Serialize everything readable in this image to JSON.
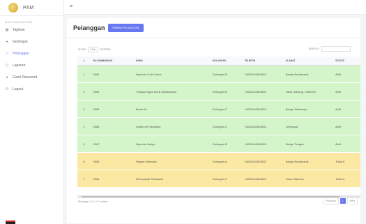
{
  "app": {
    "name": "PAM"
  },
  "sidebar": {
    "header": "MAIN NAVIGATION",
    "items": [
      {
        "label": "Tagihan",
        "icon": "table-icon"
      },
      {
        "label": "Golongan",
        "icon": "circle-icon"
      },
      {
        "label": "Pelanggan",
        "icon": "users-icon",
        "active": true
      },
      {
        "label": "Laporan",
        "icon": "document-icon"
      },
      {
        "label": "Ganti Password",
        "icon": "key-icon"
      },
      {
        "label": "Logout",
        "icon": "power-icon"
      }
    ]
  },
  "topbar": {
    "menu_icon": "hamburger-icon"
  },
  "page": {
    "title": "Pelanggan",
    "add_button": "TAMBAH PELANGGAN"
  },
  "table_controls": {
    "show_label": "SHOW",
    "show_value": "10",
    "entries_label": "ENTRIES",
    "search_label": "SEARCH:"
  },
  "table": {
    "columns": [
      "#",
      "NO SAMBUNGAN",
      "NAMA",
      "GOLONGAN",
      "TELEPON",
      "ALAMAT",
      "STATUS"
    ],
    "rows": [
      {
        "no": "1",
        "samb": "0081",
        "nama": "Nyoman Yudi Utama",
        "gol": "Golongan B",
        "tel": "+6282146824652",
        "alamat": "Banjar Budamanis",
        "status": "Aktif",
        "color": "green"
      },
      {
        "no": "2",
        "samb": "0082",
        "nama": "I Wayan Agus Nova Swatnayasa",
        "gol": "Golongan B",
        "tel": "+6282146824652",
        "alamat": "Desa Taliseng, Sidemen",
        "status": "Aktif",
        "color": "green"
      },
      {
        "no": "3",
        "samb": "0085",
        "nama": "Made Ari",
        "gol": "Golongan F",
        "tel": "+6282146824652",
        "alamat": "Banjar Sidakarya",
        "status": "Aktif",
        "color": "green"
      },
      {
        "no": "4",
        "samb": "0086",
        "nama": "Kadek Ari Harsitana",
        "gol": "Golongan C",
        "tel": "+6282146824652",
        "alamat": "Seminyak",
        "status": "Aktif",
        "color": "green"
      },
      {
        "no": "5",
        "samb": "0087",
        "nama": "Nyoman Kariya",
        "gol": "Golongan B",
        "tel": "+6282146824652",
        "alamat": "Banjar Tengah",
        "status": "Aktif",
        "color": "green"
      },
      {
        "no": "6",
        "samb": "0083",
        "nama": "Wayan Setiawan",
        "gol": "Golongan A",
        "tel": "+6282146824652",
        "alamat": "Banjar Budamanis",
        "status": "Tidak A",
        "color": "yellow"
      },
      {
        "no": "7",
        "samb": "0084",
        "nama": "Dhruwayati Tirthasiwa",
        "gol": "Golongan C",
        "tel": "+6282146824652",
        "alamat": "Desa Sidemen",
        "status": "Tidak A",
        "color": "yellow"
      }
    ]
  },
  "footer": {
    "info": "Showing 1 to 7 of 7 entries",
    "previous": "Previous",
    "page": "1",
    "next": "Next"
  },
  "colors": {
    "accent": "#6777ef",
    "active_row": "#d4f5c9",
    "inactive_row": "#fbe8a3"
  }
}
